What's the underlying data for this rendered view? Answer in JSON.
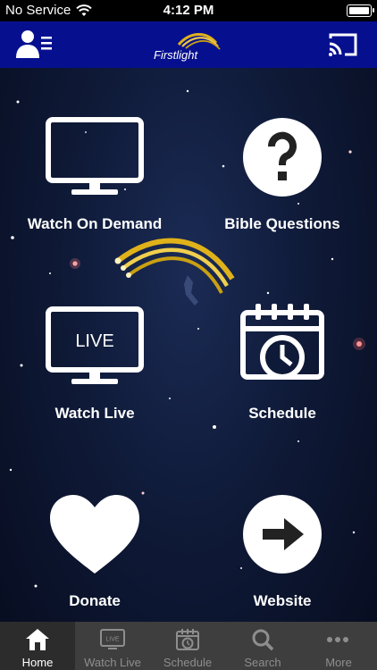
{
  "status": {
    "carrier": "No Service",
    "time": "4:12 PM"
  },
  "header": {
    "logo_text": "Firstlight"
  },
  "tiles": [
    {
      "label": "Watch On Demand",
      "icon": "tv-icon"
    },
    {
      "label": "Bible Questions",
      "icon": "question-icon"
    },
    {
      "label": "Watch Live",
      "icon": "live-tv-icon",
      "badge": "LIVE"
    },
    {
      "label": "Schedule",
      "icon": "calendar-clock-icon"
    },
    {
      "label": "Donate",
      "icon": "heart-icon"
    },
    {
      "label": "Website",
      "icon": "arrow-right-icon"
    }
  ],
  "tabs": [
    {
      "label": "Home",
      "icon": "home-icon",
      "active": true
    },
    {
      "label": "Watch Live",
      "icon": "live-tv-icon",
      "badge": "LIVE"
    },
    {
      "label": "Schedule",
      "icon": "calendar-clock-icon"
    },
    {
      "label": "Search",
      "icon": "search-icon"
    },
    {
      "label": "More",
      "icon": "more-dots-icon"
    }
  ],
  "colors": {
    "header_bg": "#06108f",
    "tabbar_bg": "#3e3e3e",
    "accent_gold": "#e0b21a"
  }
}
